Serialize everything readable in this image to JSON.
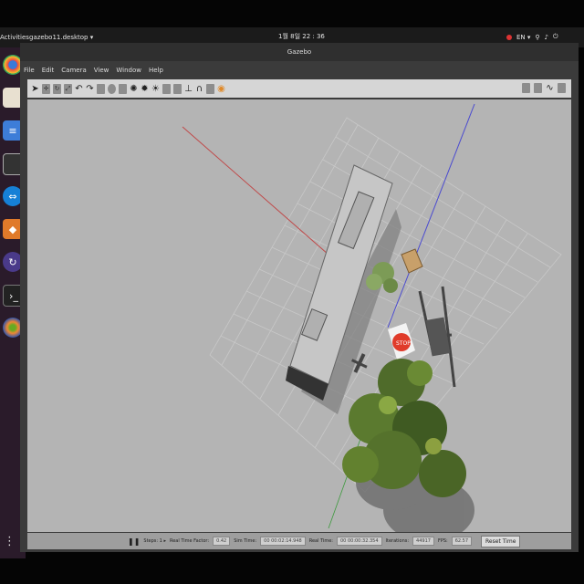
{
  "topbar": {
    "activities": "Activities",
    "app_menu": "gazebo11.desktop ▾",
    "clock": "1월 8일 22 : 36",
    "lang": "EN ▾"
  },
  "window": {
    "title": "Gazebo"
  },
  "menu": [
    "File",
    "Edit",
    "Camera",
    "View",
    "Window",
    "Help"
  ],
  "status": {
    "pause_label": "❚❚",
    "steps": "Steps: 1 ▸",
    "rtf_label": "Real Time Factor:",
    "rtf_value": "0.42",
    "sim_label": "Sim Time:",
    "sim_value": "00 00:02:14.948",
    "real_label": "Real Time:",
    "real_value": "00 00:00:32.354",
    "iter_label": "Iterations:",
    "iter_value": "44917",
    "fps_label": "FPS:",
    "fps_value": "62.57",
    "reset": "Reset Time"
  },
  "colors": {
    "viewport_bg": "#b4b4b4",
    "grid": "#c9c9c9",
    "x_axis": "#c04848",
    "y_axis": "#3d9a3d",
    "z_axis": "#4a4ad0"
  }
}
